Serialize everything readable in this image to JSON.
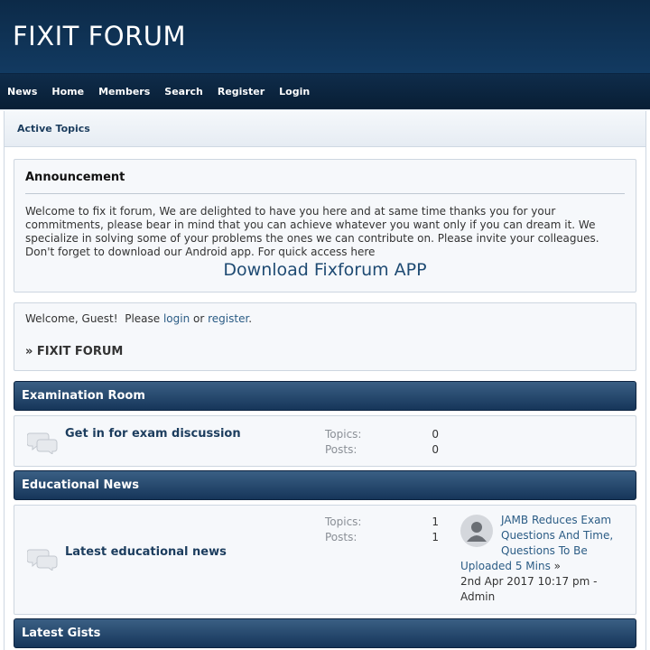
{
  "site": {
    "title": "FIXIT FORUM"
  },
  "menu": [
    "News",
    "Home",
    "Members",
    "Search",
    "Register",
    "Login"
  ],
  "navbar": {
    "active_topics": "Active Topics"
  },
  "announcement": {
    "title": "Announcement",
    "body": "Welcome to fix it forum, We are delighted to have you here and at same time thanks you for your commitments, please bear in mind that you can achieve whatever you want only if you can dream it. We specialize in solving some of your problems the ones we can contribute on. Please invite your colleagues. Don't forget to download our Android app. For quick access here",
    "download_link": "Download Fixforum APP"
  },
  "welcome": {
    "prefix": "Welcome, Guest!  Please ",
    "login": "login",
    "or": " or ",
    "register": "register",
    "suffix": ".",
    "crumb": "» FIXIT FORUM"
  },
  "categories": [
    {
      "name": "Examination Room"
    },
    {
      "name": "Educational News"
    },
    {
      "name": "Latest Gists"
    }
  ],
  "boards": [
    {
      "name": "Get in for exam discussion",
      "topics_label": "Topics:",
      "topics": "0",
      "posts_label": "Posts:",
      "posts": "0"
    },
    {
      "name": "Latest educational news",
      "topics_label": "Topics:",
      "topics": "1",
      "posts_label": "Posts:",
      "posts": "1",
      "last_post": {
        "title": "JAMB Reduces Exam Questions And Time, Questions To Be Uploaded 5 Mins",
        "arrow": " »",
        "date": "2nd Apr 2017 10:17 pm - Admin"
      }
    }
  ],
  "colors": {
    "header": "#0c2a48",
    "category_bar": "#16365a",
    "link": "#2b5c85"
  },
  "icons": [
    "board-icon",
    "avatar-icon"
  ]
}
